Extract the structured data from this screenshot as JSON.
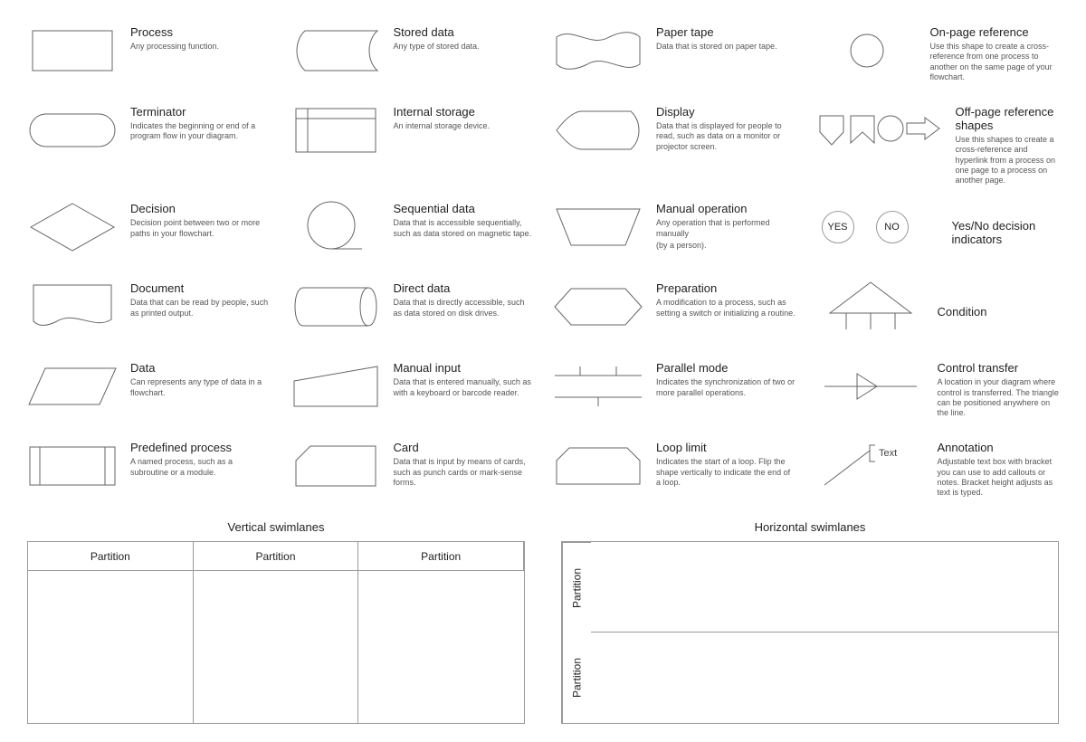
{
  "shapes": {
    "process": {
      "title": "Process",
      "desc": "Any processing function."
    },
    "terminator": {
      "title": "Terminator",
      "desc": "Indicates the beginning or end of a program flow in your diagram."
    },
    "decision": {
      "title": "Decision",
      "desc": "Decision point between two or more paths in your flowchart."
    },
    "document": {
      "title": "Document",
      "desc": "Data that can be read by people, such as printed output."
    },
    "data": {
      "title": "Data",
      "desc": "Can represents any type of data in a flowchart."
    },
    "predefined_process": {
      "title": "Predefined process",
      "desc": "A named process, such as a subroutine or a module."
    },
    "stored_data": {
      "title": "Stored data",
      "desc": "Any type of stored data."
    },
    "internal_storage": {
      "title": "Internal storage",
      "desc": "An internal storage device."
    },
    "sequential_data": {
      "title": "Sequential data",
      "desc": "Data that is accessible sequentially, such as data stored on magnetic tape."
    },
    "direct_data": {
      "title": "Direct data",
      "desc": "Data that is directly accessible, such as data stored on disk drives."
    },
    "manual_input": {
      "title": "Manual input",
      "desc": "Data that is entered manually, such as with a keyboard or barcode reader."
    },
    "card": {
      "title": "Card",
      "desc": "Data that is input by means of cards, such as punch cards or mark-sense forms."
    },
    "paper_tape": {
      "title": "Paper tape",
      "desc": "Data that is stored on paper tape."
    },
    "display": {
      "title": "Display",
      "desc": "Data that is displayed for people to read, such as data on a monitor or projector screen."
    },
    "manual_operation": {
      "title": "Manual operation",
      "desc": "Any operation that is performed manually",
      "desc2": "(by a person)."
    },
    "preparation": {
      "title": "Preparation",
      "desc": "A modification to a process, such as setting a switch or initializing a routine."
    },
    "parallel_mode": {
      "title": "Parallel mode",
      "desc": "Indicates the synchronization of two or more parallel operations."
    },
    "loop_limit": {
      "title": "Loop limit",
      "desc": "Indicates the start of a loop. Flip the shape vertically to indicate the end of a loop."
    },
    "on_page_reference": {
      "title": "On-page reference",
      "desc": "Use this shape to create a cross-reference from one process to another on the same page of your flowchart."
    },
    "off_page_reference": {
      "title": "Off-page reference shapes",
      "desc": "Use this shapes to create a cross-reference and hyperlink from a process on one page to a process on another page."
    },
    "yes_no": {
      "title": "Yes/No decision indicators",
      "yes": "YES",
      "no": "NO"
    },
    "condition": {
      "title": "Condition"
    },
    "control_transfer": {
      "title": "Control transfer",
      "desc": "A location in your diagram where control is transferred. The triangle can be positioned anywhere on the line."
    },
    "annotation": {
      "title": "Annotation",
      "label": "Text",
      "desc": "Adjustable text box with bracket you can use to add callouts or notes. Bracket height adjusts as text is typed."
    }
  },
  "swimlanes": {
    "vertical_title": "Vertical swimlanes",
    "horizontal_title": "Horizontal swimlanes",
    "partition": "Partition"
  }
}
